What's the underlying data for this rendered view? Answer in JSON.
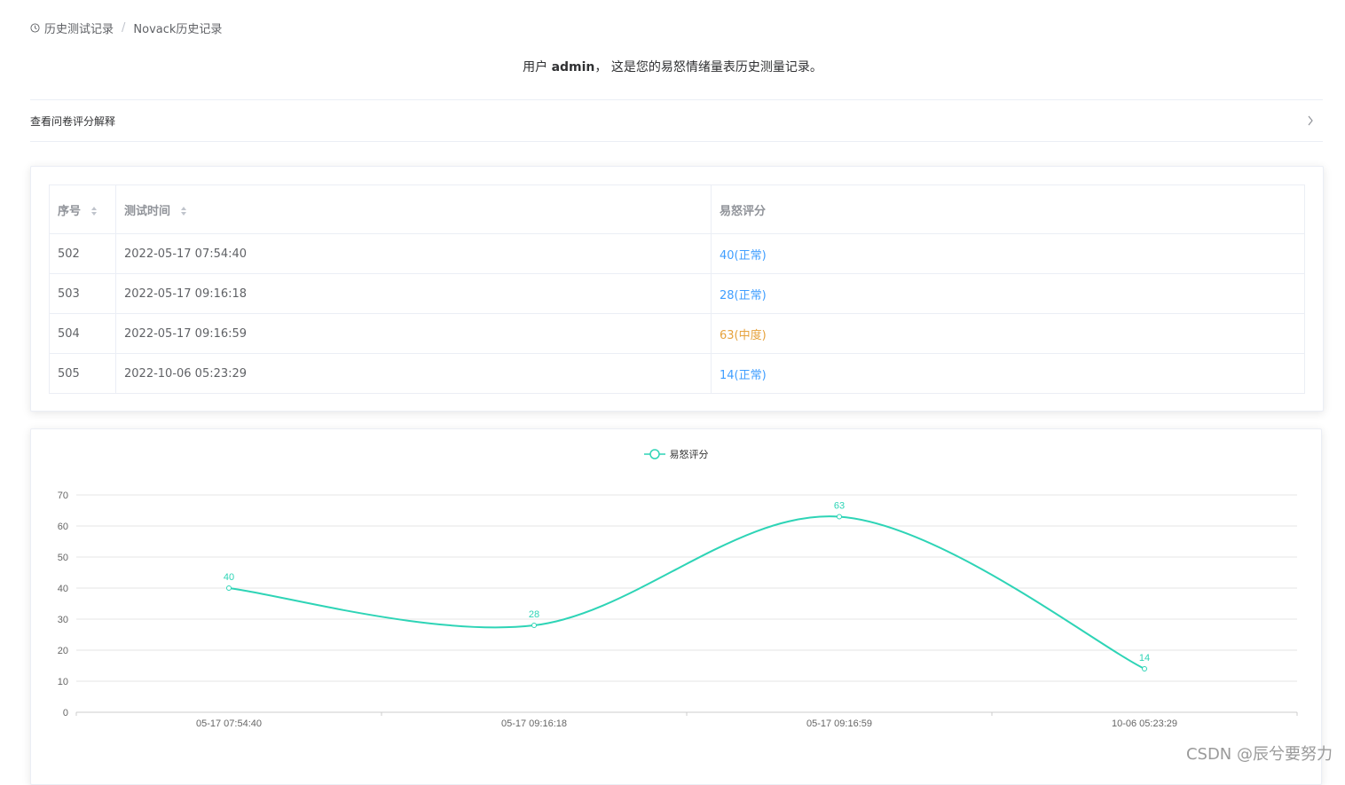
{
  "breadcrumb": {
    "icon": "clock-icon",
    "items": [
      "历史测试记录",
      "Novack历史记录"
    ],
    "separator": "/"
  },
  "intro": {
    "prefix": "用户",
    "username": "admin",
    "suffix": "， 这是您的易怒情绪量表历史测量记录。"
  },
  "collapse": {
    "title": "查看问卷评分解释",
    "icon": "chevron-right-icon"
  },
  "table": {
    "headers": [
      "序号",
      "测试时间",
      "易怒评分"
    ],
    "rows": [
      {
        "id": "502",
        "time": "2022-05-17 07:54:40",
        "score": "40(正常)",
        "level": "normal"
      },
      {
        "id": "503",
        "time": "2022-05-17 09:16:18",
        "score": "28(正常)",
        "level": "normal"
      },
      {
        "id": "504",
        "time": "2022-05-17 09:16:59",
        "score": "63(中度)",
        "level": "moderate"
      },
      {
        "id": "505",
        "time": "2022-10-06 05:23:29",
        "score": "14(正常)",
        "level": "normal"
      }
    ]
  },
  "colors": {
    "line": "#2ed4b6",
    "normal": "#409eff",
    "moderate": "#e6a23c"
  },
  "chart_data": {
    "type": "line",
    "smooth": true,
    "categories": [
      "05-17 07:54:40",
      "05-17 09:16:18",
      "05-17 09:16:59",
      "10-06 05:23:29"
    ],
    "series": [
      {
        "name": "易怒评分",
        "values": [
          40,
          28,
          63,
          14
        ]
      }
    ],
    "yticks": [
      0,
      10,
      20,
      30,
      40,
      50,
      60,
      70
    ],
    "ylim": [
      0,
      70
    ],
    "grid": true,
    "legend": "top-center",
    "data_labels": true
  },
  "watermark": "CSDN @辰兮要努力"
}
